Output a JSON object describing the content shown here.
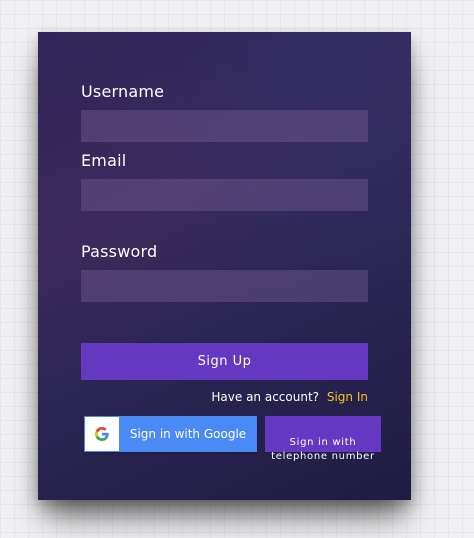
{
  "form": {
    "username_label": "Username",
    "username_value": "",
    "email_label": "Email",
    "email_value": "",
    "password_label": "Password",
    "password_value": "",
    "signup_label": "Sign Up",
    "have_account_text": "Have an account?",
    "signin_link": "Sign In",
    "google_label": "Sign in with Google",
    "phone_label_line1": "Sign in with",
    "phone_label_line2": "telephone number"
  },
  "colors": {
    "accent": "#6438c0",
    "link": "#f5c518",
    "google_blue": "#4a8af4"
  },
  "icons": {
    "google": "google-g-icon"
  }
}
